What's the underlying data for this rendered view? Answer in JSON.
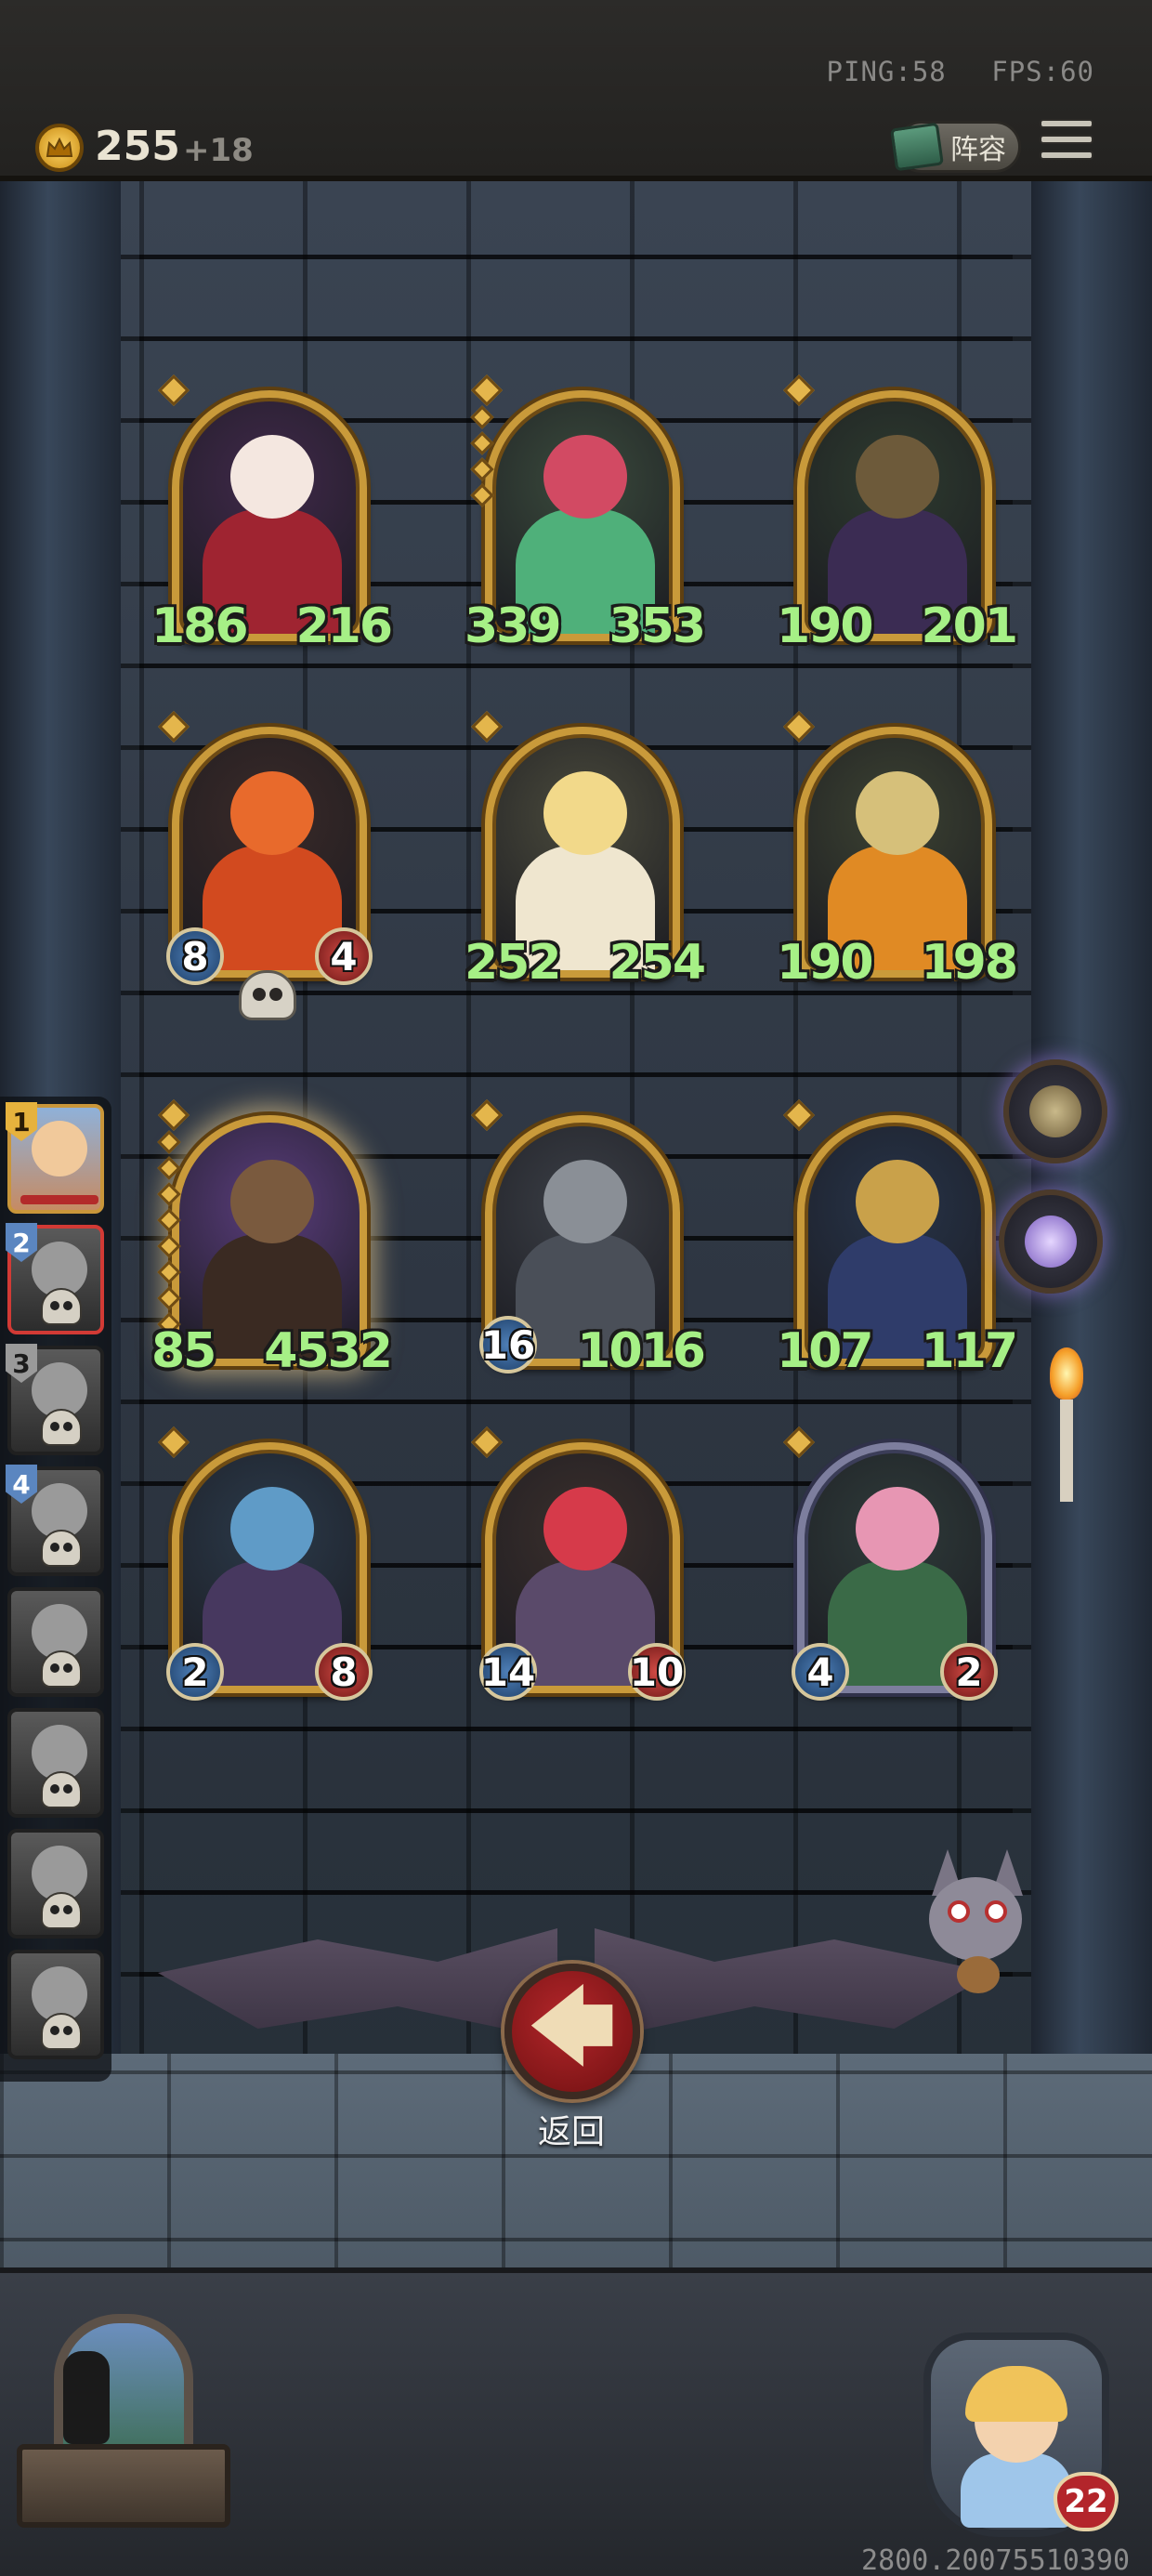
{
  "hud": {
    "ping": "PING:58",
    "fps": "FPS:60",
    "coins": "255",
    "coin_income": "+18",
    "lineup_label": "阵容"
  },
  "board": {
    "cards": [
      {
        "atk": "186",
        "hp": "216",
        "style": "green",
        "colors": {
          "bg": "#40294a",
          "head": "#f4e7e0",
          "body": "#9f2431"
        }
      },
      {
        "atk": "339",
        "hp": "353",
        "style": "green",
        "colors": {
          "bg": "#3a4a3c",
          "head": "#d24a63",
          "body": "#4fb07a"
        }
      },
      {
        "atk": "190",
        "hp": "201",
        "style": "green",
        "colors": {
          "bg": "#2e3b2f",
          "head": "#6d5a3a",
          "body": "#3b2c53"
        }
      },
      {
        "atk": "8",
        "hp": "4",
        "style": "orb",
        "colors": {
          "bg": "#3a2a28",
          "head": "#e86a2c",
          "body": "#d24a1f"
        }
      },
      {
        "atk": "252",
        "hp": "254",
        "style": "green",
        "colors": {
          "bg": "#4a4a3c",
          "head": "#f2d98a",
          "body": "#efe6cf"
        }
      },
      {
        "atk": "190",
        "hp": "198",
        "style": "green",
        "colors": {
          "bg": "#3c4232",
          "head": "#d6c07a",
          "body": "#e08a24"
        }
      },
      {
        "atk": "85",
        "hp": "4532",
        "style": "green",
        "glow": true,
        "colors": {
          "bg": "#5a3d7c",
          "head": "#7a5a3e",
          "body": "#3a2a22"
        }
      },
      {
        "atk": "16",
        "hp": "1016",
        "style": "mixed",
        "colors": {
          "bg": "#3b3f46",
          "head": "#8a8f96",
          "body": "#4a4f58"
        }
      },
      {
        "atk": "107",
        "hp": "117",
        "style": "green",
        "colors": {
          "bg": "#273449",
          "head": "#c9a14a",
          "body": "#2f3c6a"
        }
      },
      {
        "atk": "2",
        "hp": "8",
        "style": "orb",
        "colors": {
          "bg": "#2b3a4a",
          "head": "#5f9bc7",
          "body": "#47385f"
        }
      },
      {
        "atk": "14",
        "hp": "10",
        "style": "orb",
        "colors": {
          "bg": "#3a2f2c",
          "head": "#d63a4a",
          "body": "#5a4a6a"
        }
      },
      {
        "atk": "4",
        "hp": "2",
        "style": "orb",
        "silver": true,
        "colors": {
          "bg": "#2f3b3a",
          "head": "#e796b3",
          "body": "#3a6a47"
        }
      }
    ]
  },
  "queue": {
    "items": [
      {
        "num": "1",
        "badge": "gold",
        "state": "active"
      },
      {
        "num": "2",
        "badge": "blue",
        "state": "selected"
      },
      {
        "num": "3",
        "badge": "grey",
        "state": "dead"
      },
      {
        "num": "4",
        "badge": "blue",
        "state": "dead"
      },
      {
        "num": "",
        "badge": "",
        "state": "dead"
      },
      {
        "num": "",
        "badge": "",
        "state": "dead"
      },
      {
        "num": "",
        "badge": "",
        "state": "dead"
      },
      {
        "num": "",
        "badge": "",
        "state": "dead"
      }
    ]
  },
  "back_label": "返回",
  "player": {
    "hp": "22"
  },
  "version": "2800.20075510390",
  "icons": {
    "coin": "crown-coin-icon",
    "lineup": "book-icon",
    "menu": "hamburger-menu-icon",
    "back": "arrow-left-icon",
    "watch": "pocket-watch-icon",
    "drill": "drill-icon"
  }
}
